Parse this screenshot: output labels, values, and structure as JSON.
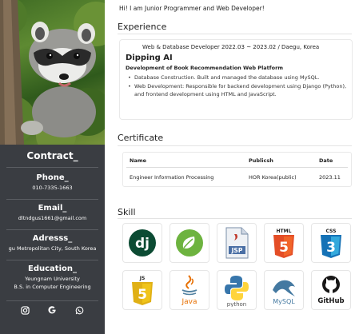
{
  "sidebar": {
    "contact_title": "Contract_",
    "phone_label": "Phone_",
    "phone": "010-7335-1663",
    "email_label": "Email_",
    "email": "dltndgus1661@gmail.com",
    "address_label": "Adresss_",
    "address": "gu Metropolitan City, South Korea",
    "education_label": "Education_",
    "school": "Yeungnam University",
    "degree": "B.S. in Computer Engineering",
    "socials": [
      "instagram-icon",
      "google-icon",
      "whatsapp-icon"
    ]
  },
  "main": {
    "intro": "Hi! I am Junior Programmer and Web Developer!",
    "experience": {
      "title": "Experience",
      "period": "Web & Database Developer 2022.03 ~ 2023.02 / Daegu, Korea",
      "company": "Dipping AI",
      "project": "Development of Book Recommendation Web Platform",
      "bullets": [
        "Database Construction. Built and managed the database using MySQL.",
        "Web Development: Responsible for backend development using Django (Python), and frontend development using HTML and JavaScript."
      ]
    },
    "certificate": {
      "title": "Certificate",
      "headers": [
        "Name",
        "Publicsh",
        "Date"
      ],
      "rows": [
        [
          "Engineer Information Processing",
          "HOR Korea(public)",
          "2023.11"
        ]
      ]
    },
    "skill": {
      "title": "Skill",
      "items": [
        {
          "name": "django-icon",
          "label": "dj"
        },
        {
          "name": "spring-icon",
          "label": ""
        },
        {
          "name": "jsp-icon",
          "label": "JSP"
        },
        {
          "name": "html5-icon",
          "label": "HTML"
        },
        {
          "name": "css3-icon",
          "label": "CSS"
        },
        {
          "name": "javascript-icon",
          "label": "JS"
        },
        {
          "name": "java-icon",
          "label": "Java"
        },
        {
          "name": "python-icon",
          "label": "python"
        },
        {
          "name": "mysql-icon",
          "label": "MySQL"
        },
        {
          "name": "github-icon",
          "label": "GitHub"
        }
      ]
    }
  },
  "colors": {
    "sidebar_bg": "#3a3d42",
    "html_orange": "#e44d26",
    "css_blue": "#2965f1",
    "js_yellow": "#f0c419",
    "django_green": "#0c4b33",
    "spring_green": "#6db33f",
    "mysql_blue": "#4479a1"
  }
}
